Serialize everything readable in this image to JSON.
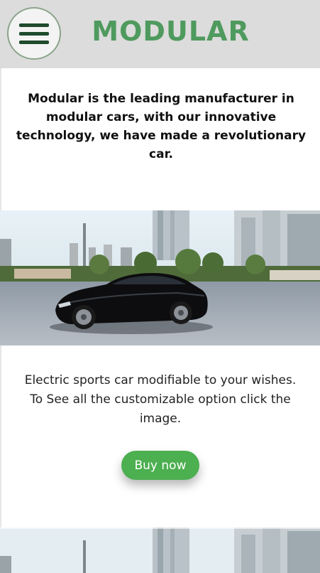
{
  "header": {
    "brand": "MODULAR",
    "menu_icon": "hamburger-menu-icon"
  },
  "intro": {
    "text": "Modular is the leading manufacturer in modular cars, with our innovative technology, we have made a revolutionary car."
  },
  "product": {
    "image_icon": "car-photo",
    "description": "Electric sports car modifiable to your wishes. To See all the customizable option click the image.",
    "buy_label": "Buy now"
  },
  "colors": {
    "header_bg": "#dcdcdc",
    "brand": "#4f9a5e",
    "menu_bars": "#1f4a2b",
    "buy_button": "#4caf50"
  }
}
